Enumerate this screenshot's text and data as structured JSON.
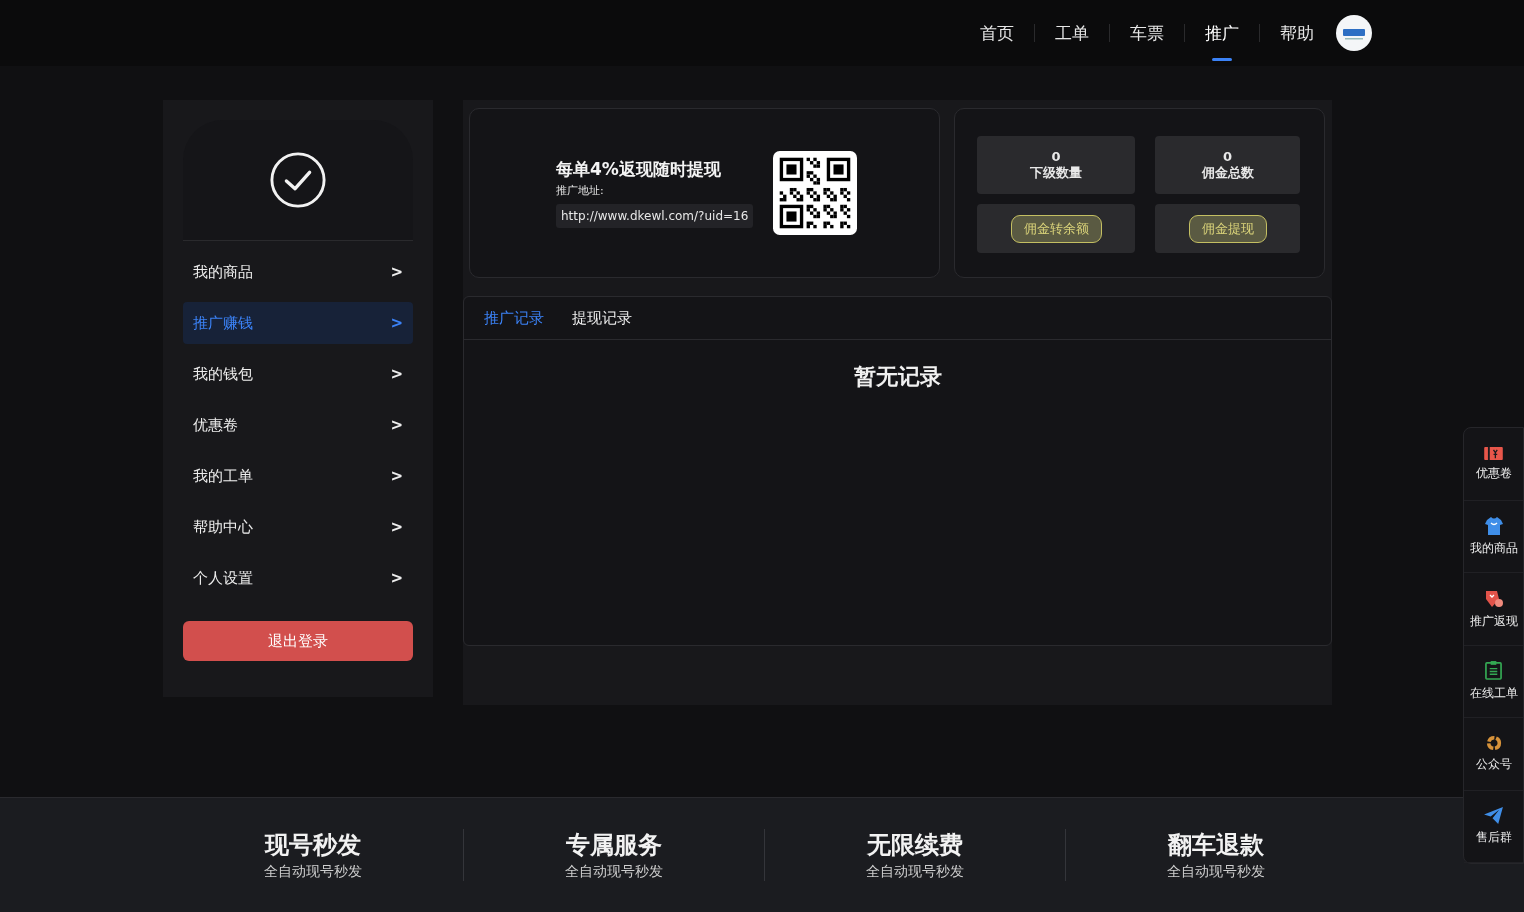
{
  "nav": [
    {
      "label": "首页",
      "selected": false
    },
    {
      "label": "工单",
      "selected": false
    },
    {
      "label": "车票",
      "selected": false
    },
    {
      "label": "推广",
      "selected": true
    },
    {
      "label": "帮助",
      "selected": false
    }
  ],
  "sidebar": {
    "items": [
      {
        "label": "我的商品",
        "arrow": ">",
        "selected": false
      },
      {
        "label": "推广赚钱",
        "arrow": ">",
        "selected": true
      },
      {
        "label": "我的钱包",
        "arrow": ">",
        "selected": false
      },
      {
        "label": "优惠卷",
        "arrow": ">",
        "selected": false
      },
      {
        "label": "我的工单",
        "arrow": ">",
        "selected": false
      },
      {
        "label": "帮助中心",
        "arrow": ">",
        "selected": false
      },
      {
        "label": "个人设置",
        "arrow": ">",
        "selected": false
      }
    ],
    "logout": "退出登录"
  },
  "promo": {
    "title": "每单4%返现随时提现",
    "address_label": "推广地址:",
    "address": "http://www.dkewl.com/?uid=16"
  },
  "stats": [
    {
      "value": "0",
      "label": "下级数量"
    },
    {
      "value": "0",
      "label": "佣金总数"
    }
  ],
  "actions": [
    "佣金转余额",
    "佣金提现"
  ],
  "tabs": [
    {
      "label": "推广记录",
      "selected": true
    },
    {
      "label": "提现记录",
      "selected": false
    }
  ],
  "empty": "暂无记录",
  "float_bar": [
    {
      "kind": "coupon",
      "label": "优惠卷"
    },
    {
      "kind": "shirt",
      "label": "我的商品"
    },
    {
      "kind": "gift",
      "label": "推广返现"
    },
    {
      "kind": "clipboard",
      "label": "在线工单"
    },
    {
      "kind": "ring",
      "label": "公众号"
    },
    {
      "kind": "plane",
      "label": "售后群"
    }
  ],
  "features": [
    {
      "title": "现号秒发",
      "subtitle": "全自动现号秒发"
    },
    {
      "title": "专属服务",
      "subtitle": "全自动现号秒发"
    },
    {
      "title": "无限续费",
      "subtitle": "全自动现号秒发"
    },
    {
      "title": "翻车退款",
      "subtitle": "全自动现号秒发"
    }
  ]
}
